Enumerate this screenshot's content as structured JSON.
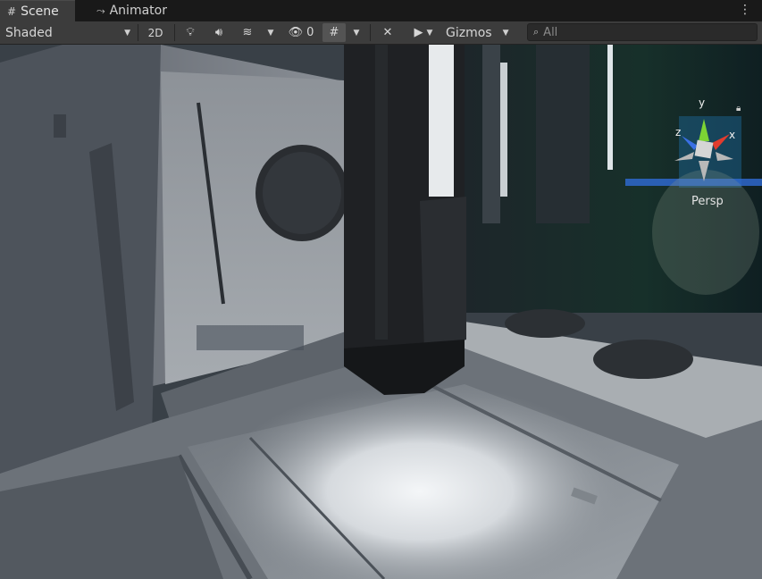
{
  "tabs": [
    {
      "label": "Scene",
      "icon": "grid-icon",
      "active": true
    },
    {
      "label": "Animator",
      "icon": "animator-icon",
      "active": false
    }
  ],
  "toolbar": {
    "shading_mode": "Shaded",
    "mode_2d_label": "2D",
    "hidden_count": "0",
    "gizmos_label": "Gizmos",
    "search_placeholder": "All"
  },
  "scene_gizmo": {
    "x_label": "x",
    "y_label": "y",
    "z_label": "z",
    "projection_label": "Persp",
    "colors": {
      "x": "#e23b2e",
      "y": "#7cd334",
      "z": "#3a6fe4"
    }
  }
}
